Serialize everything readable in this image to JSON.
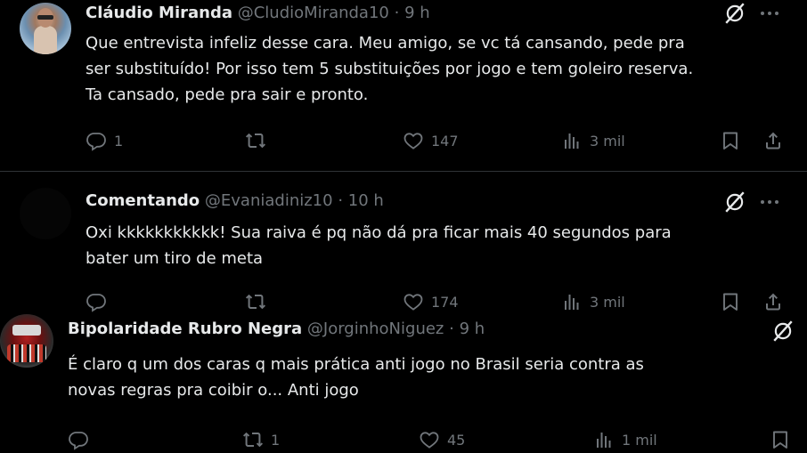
{
  "tweets": [
    {
      "name": "Cláudio Miranda",
      "handle": "@CludioMiranda10",
      "time": "9 h",
      "lines": [
        "Que entrevista infeliz desse cara. Meu amigo, se vc tá cansando, pede pra",
        "ser substituído! Por isso tem 5 substituições por jogo e tem goleiro reserva.",
        "Ta cansado, pede pra sair e pronto."
      ],
      "replies": "1",
      "reposts": "",
      "likes": "147",
      "views": "3 mil"
    },
    {
      "name": "Comentando",
      "handle": "@Evaniadiniz10",
      "time": "10 h",
      "lines": [
        "Oxi kkkkkkkkkkk! Sua raiva é pq não dá pra ficar mais 40 segundos para",
        "bater um tiro de meta"
      ],
      "replies": "",
      "reposts": "",
      "likes": "174",
      "views": "3 mil"
    },
    {
      "name": "Bipolaridade Rubro Negra",
      "handle": "@JorginhoNiguez",
      "time": "9 h",
      "lines": [
        "É claro q um dos caras q mais prática anti jogo no Brasil seria contra as",
        "novas regras pra coibir o... Anti jogo"
      ],
      "replies": "",
      "reposts": "1",
      "likes": "45",
      "views": "1 mil"
    }
  ],
  "separator": "·",
  "colors": {
    "background": "#000000",
    "text": "#e7e9ea",
    "muted": "#71767b",
    "divider": "#2f3336"
  },
  "icons": [
    "grok-icon",
    "more-icon",
    "reply-icon",
    "repost-icon",
    "like-icon",
    "views-icon",
    "bookmark-icon",
    "share-icon"
  ]
}
